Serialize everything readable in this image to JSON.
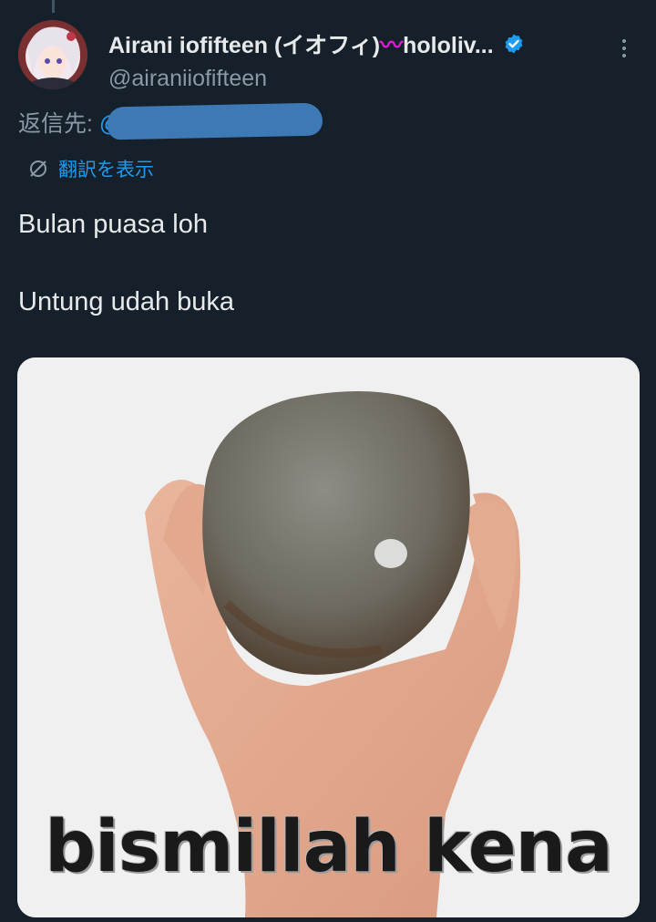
{
  "author": {
    "display_name": "Airani iofifteen (イオフィ)",
    "display_name_emoji": "🎨",
    "display_name_suffix": "hololiv...",
    "handle": "@airaniiofifteen",
    "verified": true,
    "avatar_icon": "avatar-icon"
  },
  "reply": {
    "label": "返信先:",
    "mention_start": "@"
  },
  "translate": {
    "label": "翻訳を表示",
    "icon": "translate-icon"
  },
  "tweet": {
    "line1": "Bulan puasa loh",
    "line2": "Untung udah buka"
  },
  "media": {
    "caption": "bismillah kena"
  },
  "colors": {
    "background": "#15202b",
    "primary_text": "#e7e9ea",
    "secondary_text": "#8b98a5",
    "accent": "#1d9bf0",
    "redaction": "#3d7ab5"
  }
}
